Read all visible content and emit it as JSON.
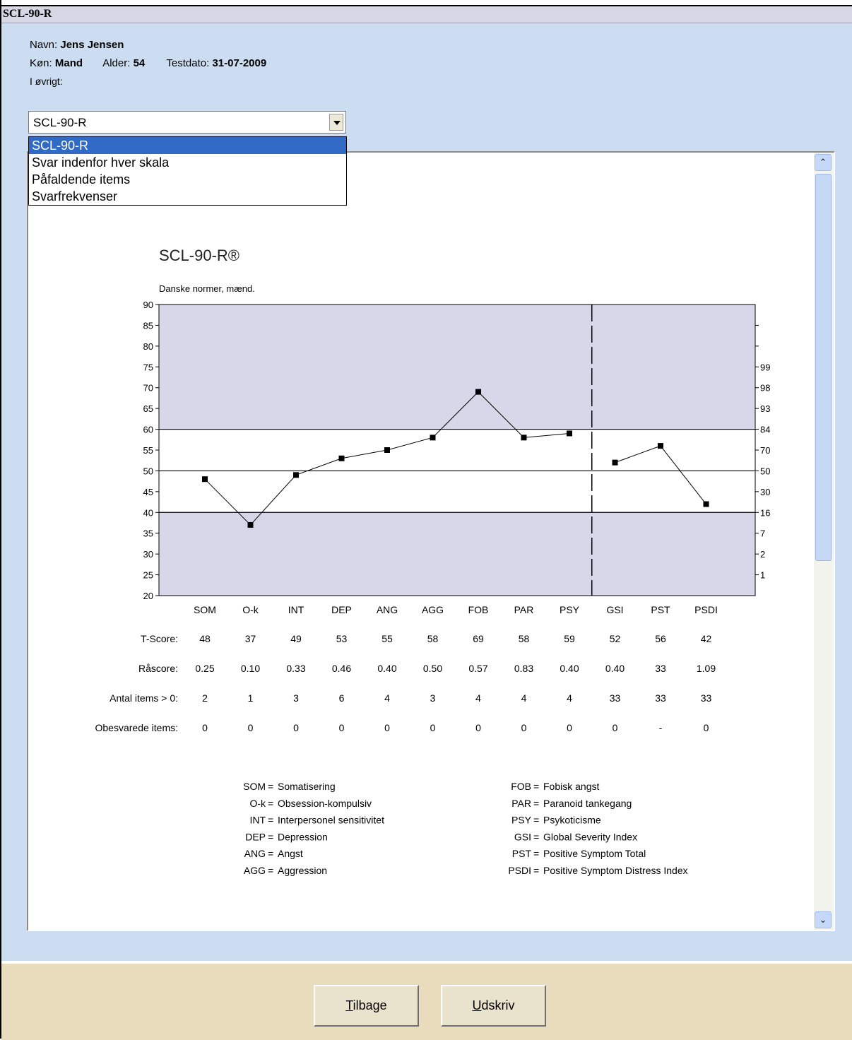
{
  "window": {
    "title": "SCL-90-R"
  },
  "patient": {
    "name_label": "Navn:",
    "name": "Jens Jensen",
    "gender_label": "Køn:",
    "gender": "Mand",
    "age_label": "Alder:",
    "age": "54",
    "date_label": "Testdato:",
    "date": "31-07-2009",
    "other_label": "I øvrigt:"
  },
  "report_select": {
    "selected": "SCL-90-R",
    "options": [
      "SCL-90-R",
      "Svar indenfor hver skala",
      "Påfaldende items",
      "Svarfrekvenser"
    ]
  },
  "chart_data": {
    "type": "line",
    "title": "SCL-90-R®",
    "subtitle": "Danske normer, mænd.",
    "categories": [
      "SOM",
      "O-k",
      "INT",
      "DEP",
      "ANG",
      "AGG",
      "FOB",
      "PAR",
      "PSY",
      "GSI",
      "PST",
      "PSDI"
    ],
    "series": [
      {
        "values": [
          48,
          37,
          49,
          53,
          55,
          58,
          69,
          58,
          59,
          null,
          null,
          null
        ]
      },
      {
        "values": [
          null,
          null,
          null,
          null,
          null,
          null,
          null,
          null,
          null,
          52,
          56,
          42
        ]
      }
    ],
    "ylim": [
      20,
      90
    ],
    "yticks": [
      20,
      25,
      30,
      35,
      40,
      45,
      50,
      55,
      60,
      65,
      70,
      75,
      80,
      85,
      90
    ],
    "right_axis_ticks": [
      {
        "y": 25,
        "label": "1"
      },
      {
        "y": 30,
        "label": "2"
      },
      {
        "y": 35,
        "label": "7"
      },
      {
        "y": 40,
        "label": "16"
      },
      {
        "y": 45,
        "label": "30"
      },
      {
        "y": 50,
        "label": "50"
      },
      {
        "y": 55,
        "label": "70"
      },
      {
        "y": 60,
        "label": "84"
      },
      {
        "y": 65,
        "label": "93"
      },
      {
        "y": 70,
        "label": "98"
      },
      {
        "y": 75,
        "label": "99"
      },
      {
        "y": 80,
        "label": ""
      },
      {
        "y": 85,
        "label": ""
      }
    ],
    "normal_band": [
      40,
      60
    ],
    "reference_line": 50,
    "divider_after_category": "PSY",
    "shaded_color": "#d6d7e8"
  },
  "score_table": {
    "rows": [
      {
        "label": "T-Score:",
        "values": [
          "48",
          "37",
          "49",
          "53",
          "55",
          "58",
          "69",
          "58",
          "59",
          "52",
          "56",
          "42"
        ]
      },
      {
        "label": "Råscore:",
        "values": [
          "0.25",
          "0.10",
          "0.33",
          "0.46",
          "0.40",
          "0.50",
          "0.57",
          "0.83",
          "0.40",
          "0.40",
          "33",
          "1.09"
        ]
      },
      {
        "label": "Antal items > 0:",
        "values": [
          "2",
          "1",
          "3",
          "6",
          "4",
          "3",
          "4",
          "4",
          "4",
          "33",
          "33",
          "33"
        ]
      },
      {
        "label": "Obesvarede items:",
        "values": [
          "0",
          "0",
          "0",
          "0",
          "0",
          "0",
          "0",
          "0",
          "0",
          "0",
          "-",
          "0"
        ]
      }
    ]
  },
  "legend": {
    "left": [
      {
        "abbr": "SOM",
        "text": "Somatisering"
      },
      {
        "abbr": "O-k",
        "text": "Obsession-kompulsiv"
      },
      {
        "abbr": "INT",
        "text": "Interpersonel sensitivitet"
      },
      {
        "abbr": "DEP",
        "text": "Depression"
      },
      {
        "abbr": "ANG",
        "text": "Angst"
      },
      {
        "abbr": "AGG",
        "text": "Aggression"
      }
    ],
    "right": [
      {
        "abbr": "FOB",
        "text": "Fobisk angst"
      },
      {
        "abbr": "PAR",
        "text": "Paranoid tankegang"
      },
      {
        "abbr": "PSY",
        "text": "Psykoticisme"
      },
      {
        "abbr": "GSI",
        "text": "Global Severity Index"
      },
      {
        "abbr": "PST",
        "text": "Positive Symptom Total"
      },
      {
        "abbr": "PSDI",
        "text": "Positive Symptom Distress Index"
      }
    ]
  },
  "buttons": {
    "back_mnemonic": "T",
    "back_rest": "ilbage",
    "print_mnemonic": "U",
    "print_rest": "dskriv"
  },
  "scrollbar": {
    "up_glyph": "⌃",
    "down_glyph": "⌄"
  }
}
